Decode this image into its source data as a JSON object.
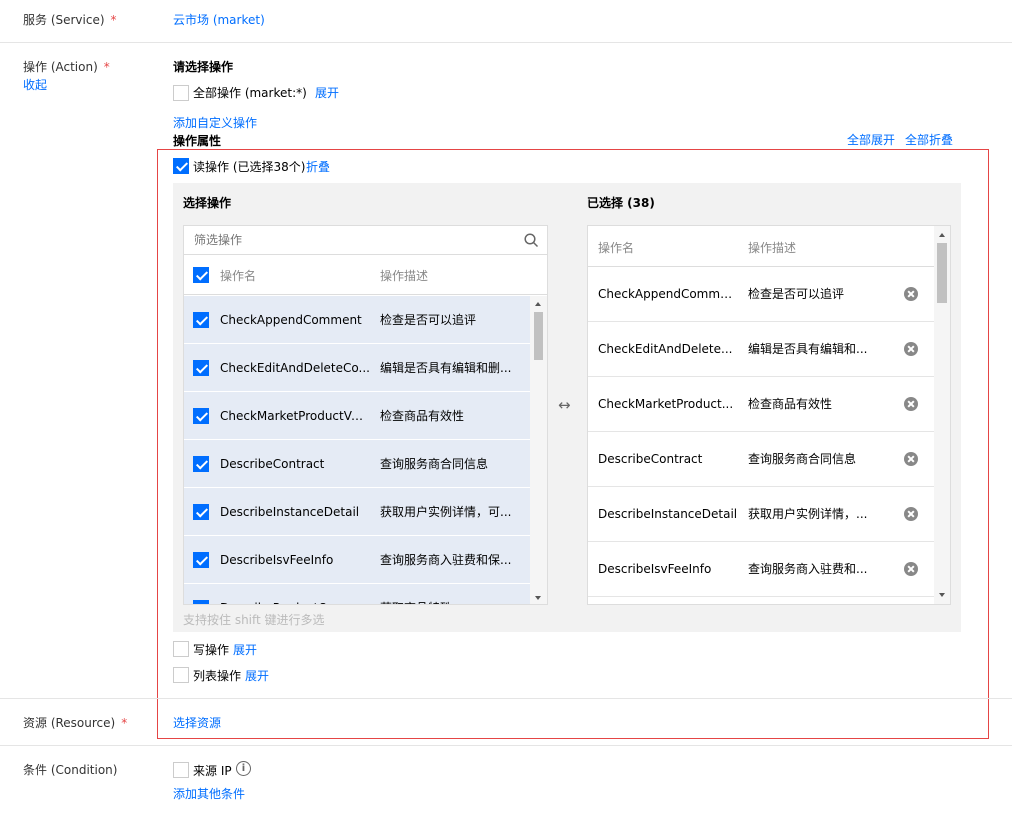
{
  "service": {
    "label": "服务 (Service)",
    "required": "*",
    "value": "云市场 (market)"
  },
  "action": {
    "label": "操作 (Action)",
    "required": "*",
    "collapse_link": "收起",
    "choose_title": "请选择操作",
    "all_ops_label": "全部操作 (market:*)",
    "all_ops_expand": "展开",
    "add_custom": "添加自定义操作",
    "props_title": "操作属性",
    "expand_all": "全部展开",
    "collapse_all": "全部折叠",
    "read": {
      "label": "读操作 (已选择38个)",
      "toggle": "折叠"
    },
    "select_panel": {
      "title": "选择操作",
      "search_placeholder": "筛选操作",
      "col_name": "操作名",
      "col_desc": "操作描述",
      "rows": [
        {
          "name": "CheckAppendComment",
          "desc": "检查是否可以追评"
        },
        {
          "name": "CheckEditAndDeleteCo...",
          "desc": "编辑是否具有编辑和删..."
        },
        {
          "name": "CheckMarketProductValid",
          "desc": "检查商品有效性"
        },
        {
          "name": "DescribeContract",
          "desc": "查询服务商合同信息"
        },
        {
          "name": "DescribeInstanceDetail",
          "desc": "获取用户实例详情，可..."
        },
        {
          "name": "DescribeIsvFeeInfo",
          "desc": "查询服务商入驻费和保..."
        },
        {
          "name": "DescribeProductOpera...",
          "desc": "获取商品特殊..."
        }
      ],
      "hint": "支持按住 shift 键进行多选"
    },
    "selected_panel": {
      "title": "已选择 (38)",
      "col_name": "操作名",
      "col_desc": "操作描述",
      "rows": [
        {
          "name": "CheckAppendComment",
          "desc": "检查是否可以追评"
        },
        {
          "name": "CheckEditAndDelete...",
          "desc": "编辑是否具有编辑和..."
        },
        {
          "name": "CheckMarketProduct...",
          "desc": "检查商品有效性"
        },
        {
          "name": "DescribeContract",
          "desc": "查询服务商合同信息"
        },
        {
          "name": "DescribeInstanceDetail",
          "desc": "获取用户实例详情，..."
        },
        {
          "name": "DescribeIsvFeeInfo",
          "desc": "查询服务商入驻费和..."
        }
      ]
    },
    "transfer_icon": "↔",
    "write": {
      "label": "写操作",
      "toggle": "展开"
    },
    "list": {
      "label": "列表操作",
      "toggle": "展开"
    }
  },
  "resource": {
    "label": "资源 (Resource)",
    "required": "*",
    "link": "选择资源"
  },
  "condition": {
    "label": "条件 (Condition)",
    "source_ip": "来源 IP",
    "info_icon": "i",
    "add_other": "添加其他条件"
  },
  "colors": {
    "accent": "#006eff",
    "required": "#e54545",
    "highlight_border": "#e54545"
  }
}
